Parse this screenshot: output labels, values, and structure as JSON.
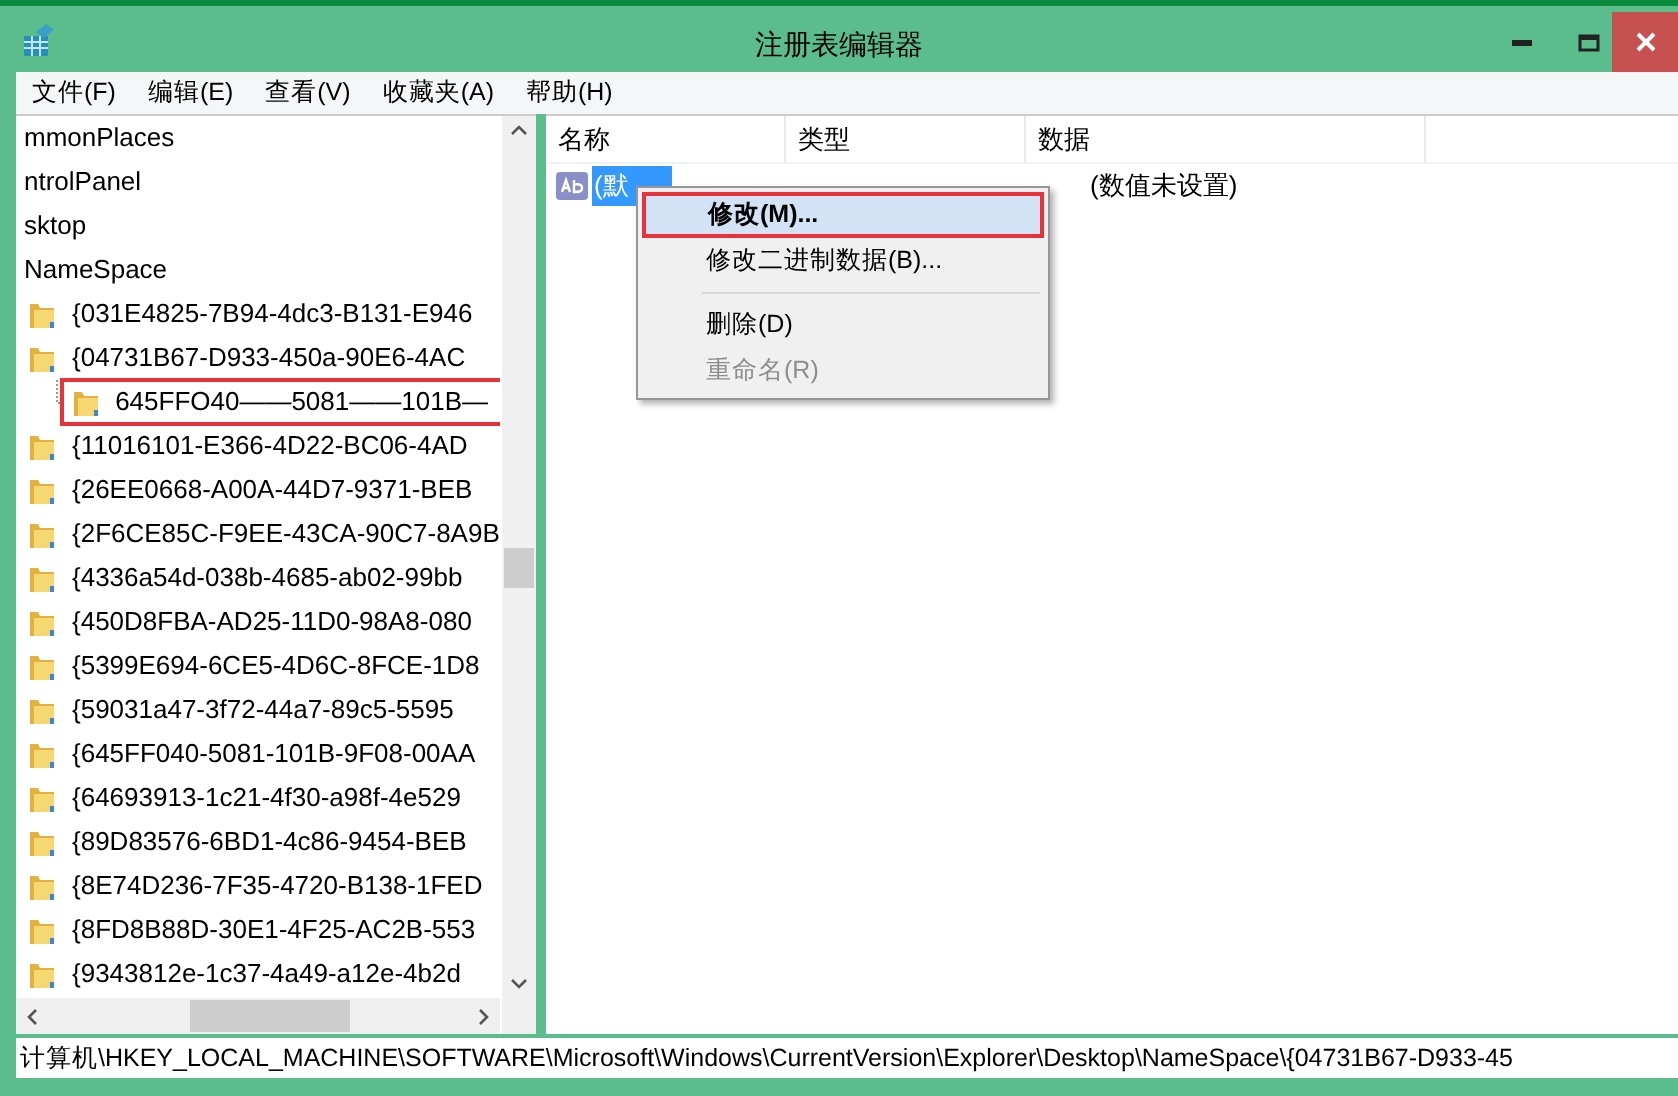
{
  "window": {
    "title": "注册表编辑器"
  },
  "menu_bar": [
    "文件(F)",
    "编辑(E)",
    "查看(V)",
    "收藏夹(A)",
    "帮助(H)"
  ],
  "tree": {
    "items": [
      {
        "label": "mmonPlaces",
        "folder": false
      },
      {
        "label": "ntrolPanel",
        "folder": false
      },
      {
        "label": "sktop",
        "folder": false
      },
      {
        "label": "NameSpace",
        "folder": false
      },
      {
        "label": "{031E4825-7B94-4dc3-B131-E946",
        "folder": true
      },
      {
        "label": "{04731B67-D933-450a-90E6-4AC",
        "folder": true,
        "children": [
          {
            "label": "645FFO40——5081——101B—",
            "folder": true,
            "annotated": true
          }
        ]
      },
      {
        "label": "{11016101-E366-4D22-BC06-4AD",
        "folder": true
      },
      {
        "label": "{26EE0668-A00A-44D7-9371-BEB",
        "folder": true
      },
      {
        "label": "{2F6CE85C-F9EE-43CA-90C7-8A9B",
        "folder": true
      },
      {
        "label": "{4336a54d-038b-4685-ab02-99bb",
        "folder": true
      },
      {
        "label": "{450D8FBA-AD25-11D0-98A8-080",
        "folder": true
      },
      {
        "label": "{5399E694-6CE5-4D6C-8FCE-1D8",
        "folder": true
      },
      {
        "label": "{59031a47-3f72-44a7-89c5-5595",
        "folder": true
      },
      {
        "label": "{645FF040-5081-101B-9F08-00AA",
        "folder": true
      },
      {
        "label": "{64693913-1c21-4f30-a98f-4e529",
        "folder": true
      },
      {
        "label": "{89D83576-6BD1-4c86-9454-BEB",
        "folder": true
      },
      {
        "label": "{8E74D236-7F35-4720-B138-1FED",
        "folder": true
      },
      {
        "label": "{8FD8B88D-30E1-4F25-AC2B-553",
        "folder": true
      },
      {
        "label": "{9343812e-1c37-4a49-a12e-4b2d",
        "folder": true
      }
    ]
  },
  "values": {
    "columns": [
      "名称",
      "类型",
      "数据"
    ],
    "rows": [
      {
        "name": "(默",
        "data": "(数值未设置)",
        "selected": true
      }
    ]
  },
  "context_menu": [
    {
      "kind": "item",
      "label": "修改(M)...",
      "bold": true,
      "selected": true,
      "annotated": true,
      "disabled": false
    },
    {
      "kind": "item",
      "label": "修改二进制数据(B)...",
      "bold": false,
      "selected": false,
      "annotated": false,
      "disabled": false
    },
    {
      "kind": "separator"
    },
    {
      "kind": "item",
      "label": "删除(D)",
      "bold": false,
      "selected": false,
      "annotated": false,
      "disabled": false
    },
    {
      "kind": "item",
      "label": "重命名(R)",
      "bold": false,
      "selected": false,
      "annotated": false,
      "disabled": true
    }
  ],
  "status_bar": "计算机\\HKEY_LOCAL_MACHINE\\SOFTWARE\\Microsoft\\Windows\\CurrentVersion\\Explorer\\Desktop\\NameSpace\\{04731B67-D933-45"
}
